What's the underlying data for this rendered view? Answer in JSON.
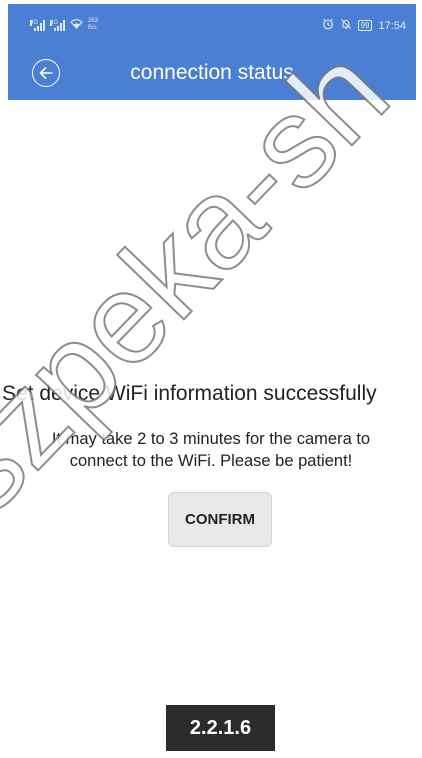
{
  "status_bar": {
    "signal1_tag": "4G",
    "signal2_tag": "4G",
    "speed_value": "263",
    "speed_unit": "B/s",
    "battery": "99",
    "time": "17:54"
  },
  "app_bar": {
    "title": "connection status"
  },
  "content": {
    "title": "Set device WiFi information successfully",
    "body_line1": "It may take 2 to 3 minutes for the camera to",
    "body_line2": "connect to the WiFi. Please be patient!",
    "confirm_label": "CONFIRM"
  },
  "version": "2.2.1.6",
  "watermark": "szpeka-sh",
  "colors": {
    "app_bar": "#4a7fd3",
    "background": "#ffffff",
    "button": "#e9e9e9",
    "badge": "#2b2b2b"
  }
}
